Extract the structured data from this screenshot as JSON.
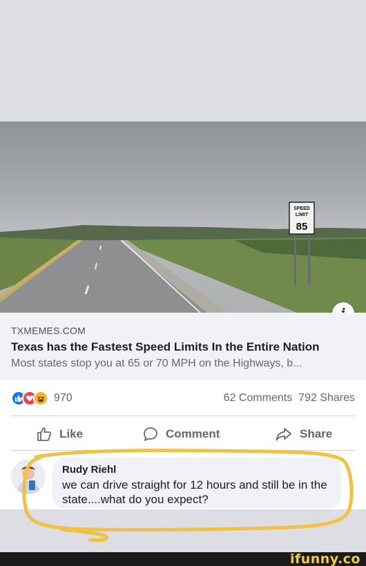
{
  "link": {
    "domain": "TXMEMES.COM",
    "headline": "Texas has the Fastest Speed Limits In the Entire Nation",
    "description": "Most states stop you at 65 or 70 MPH on the Highways, b..."
  },
  "sign": {
    "line1": "SPEED",
    "line2": "LIMIT",
    "number": "85"
  },
  "info_icon_glyph": "i",
  "stats": {
    "reaction_count": "970",
    "comments_shares": "62 Comments  792 Shares"
  },
  "actions": {
    "like": "Like",
    "comment": "Comment",
    "share": "Share"
  },
  "comment": {
    "author": "Rudy Riehl",
    "text": "we can drive straight for 12 hours and still be in the state....what do you expect?"
  },
  "watermark": "ifunny.co",
  "colors": {
    "like_blue": "#1877f2",
    "love_red": "#f33e58",
    "haha_yellow": "#f7b125",
    "scribble": "#f3bf45",
    "watermark": "#f5cf2a"
  }
}
